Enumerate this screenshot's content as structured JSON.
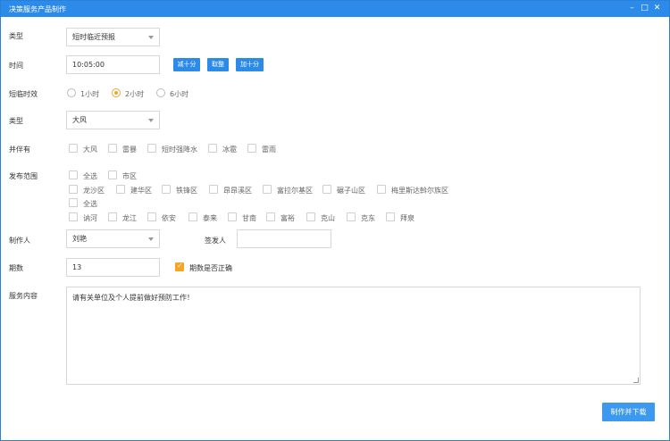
{
  "window": {
    "title": "决策服务产品制作",
    "min_icon": "minimize-icon",
    "max_icon": "maximize-icon",
    "close_icon": "close-icon"
  },
  "form": {
    "type1": {
      "label": "类型",
      "value": "短时临近预报"
    },
    "time": {
      "label": "时间",
      "value": "10:05:00",
      "minus_btn": "减十分",
      "round_btn": "取整",
      "plus_btn": "加十分"
    },
    "validity": {
      "label": "短临时效",
      "options": [
        "1小时",
        "2小时",
        "6小时"
      ],
      "selected": "2小时"
    },
    "type2": {
      "label": "类型",
      "value": "大风"
    },
    "accompany": {
      "label": "并伴有",
      "options": [
        "大风",
        "雷暴",
        "短时强降水",
        "冰雹",
        "雷雨"
      ]
    },
    "area": {
      "label": "发布范围",
      "group1_all": "全选",
      "group1_head": "市区",
      "group1_items": [
        "龙沙区",
        "建华区",
        "铁锋区",
        "昂昂溪区",
        "富拉尔基区",
        "碾子山区",
        "梅里斯达斡尔族区"
      ],
      "group2_all": "全选",
      "group2_items": [
        "讷河",
        "龙江",
        "依安",
        "泰来",
        "甘南",
        "富裕",
        "克山",
        "克东",
        "拜泉"
      ]
    },
    "maker": {
      "label": "制作人",
      "value": "刘艳"
    },
    "signer": {
      "label": "签发人",
      "value": ""
    },
    "issue": {
      "label": "期数",
      "value": "13",
      "confirm_label": "期数是否正确",
      "confirmed": true
    },
    "content": {
      "label": "服务内容",
      "value": "请有关单位及个人提前做好预防工作！"
    },
    "submit_label": "制作并下载"
  },
  "colors": {
    "titlebar": "#2c8ae8",
    "button": "#2c8ae8",
    "accent": "#f5a623"
  }
}
